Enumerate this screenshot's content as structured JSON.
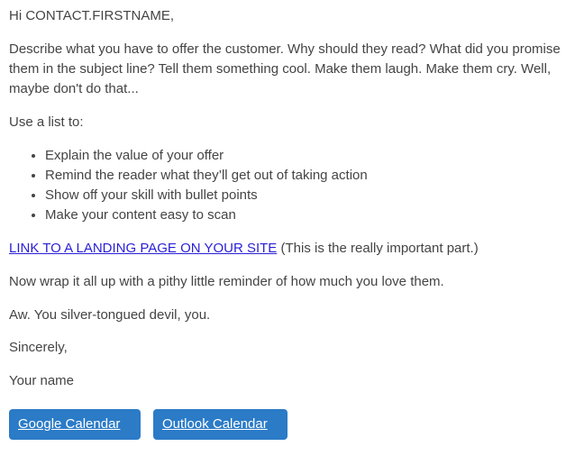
{
  "email": {
    "greeting": "Hi CONTACT.FIRSTNAME,",
    "intro": "Describe what you have to offer the customer. Why should they read? What did you promise them in the subject line? Tell them something cool. Make them laugh. Make them cry. Well, maybe don't do that...",
    "list_intro": "Use a list to:",
    "list_items": [
      "Explain the value of your offer",
      "Remind the reader what they’ll get out of taking action",
      "Show off your skill with bullet points",
      "Make your content easy to scan"
    ],
    "cta_link": "LINK TO A LANDING PAGE ON YOUR SITE",
    "cta_note": " (This is the really important part.)",
    "wrap_up": "Now wrap it all up with a pithy little reminder of how much you love them.",
    "aw_line": "Aw. You silver-tongued devil, you.",
    "sign_off": "Sincerely,",
    "signature": "Your name"
  },
  "buttons": {
    "google_calendar": "Google Calendar",
    "outlook_calendar": "Outlook Calendar"
  },
  "colors": {
    "body_text": "#444444",
    "link": "#2a1fd6",
    "button_bg": "#2b7bc7",
    "button_text": "#ffffff"
  }
}
